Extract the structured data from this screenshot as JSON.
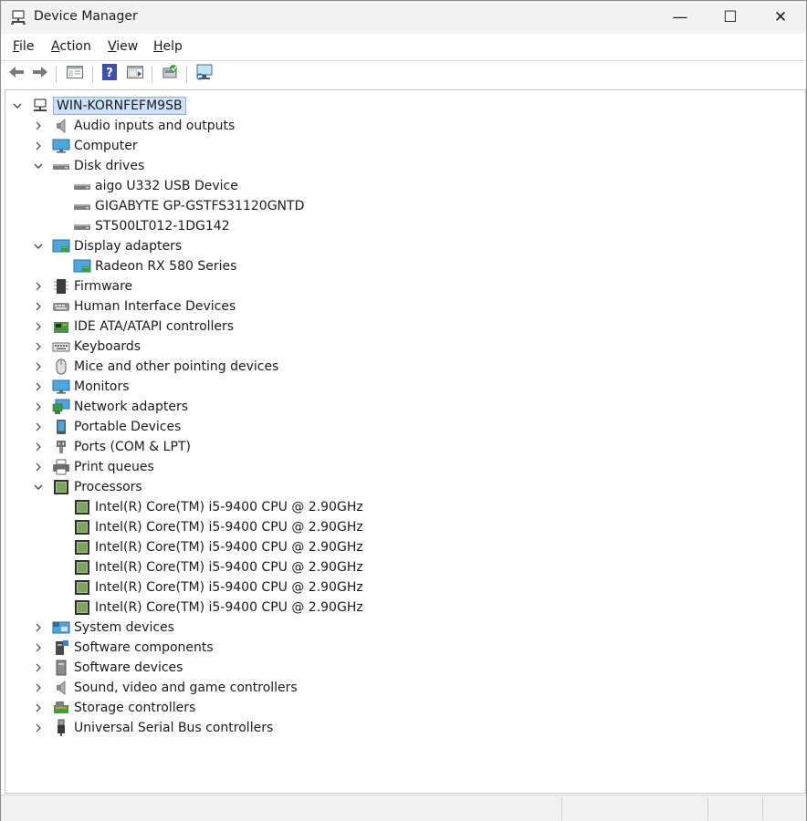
{
  "window": {
    "title": "Device Manager",
    "app_icon": "device-manager-icon",
    "controls": {
      "minimize": "—",
      "maximize": "☐",
      "close": "✕"
    }
  },
  "menu": {
    "file": {
      "mnemonic": "F",
      "rest": "ile"
    },
    "action": {
      "mnemonic": "A",
      "rest": "ction"
    },
    "view": {
      "mnemonic": "V",
      "rest": "iew"
    },
    "help": {
      "mnemonic": "H",
      "rest": "elp"
    }
  },
  "toolbar": {
    "buttons": [
      "back-arrow-icon",
      "forward-arrow-icon",
      "show-hide-console-tree-icon",
      "help-icon",
      "properties-icon",
      "update-driver-icon",
      "scan-hardware-icon"
    ]
  },
  "tree": {
    "root": {
      "label": "WIN-KORNFEFM9SB",
      "icon": "computer-network-icon"
    },
    "categories": {
      "audio": {
        "label": "Audio inputs and outputs",
        "icon": "speaker-icon"
      },
      "computer": {
        "label": "Computer",
        "icon": "monitor-icon"
      },
      "disk_drives": {
        "label": "Disk drives",
        "icon": "disk-drive-icon"
      },
      "display_adapters": {
        "label": "Display adapters",
        "icon": "display-adapter-icon"
      },
      "firmware": {
        "label": "Firmware",
        "icon": "chip-icon"
      },
      "hid": {
        "label": "Human Interface Devices",
        "icon": "hid-icon"
      },
      "ide": {
        "label": "IDE ATA/ATAPI controllers",
        "icon": "ide-controller-icon"
      },
      "keyboards": {
        "label": "Keyboards",
        "icon": "keyboard-icon"
      },
      "mice": {
        "label": "Mice and other pointing devices",
        "icon": "mouse-icon"
      },
      "monitors": {
        "label": "Monitors",
        "icon": "monitor-icon"
      },
      "network": {
        "label": "Network adapters",
        "icon": "network-adapter-icon"
      },
      "portable": {
        "label": "Portable Devices",
        "icon": "portable-device-icon"
      },
      "ports": {
        "label": "Ports (COM & LPT)",
        "icon": "port-icon"
      },
      "print_queues": {
        "label": "Print queues",
        "icon": "printer-icon"
      },
      "processors": {
        "label": "Processors",
        "icon": "processor-icon"
      },
      "system_devices": {
        "label": "System devices",
        "icon": "system-folder-icon"
      },
      "software_components": {
        "label": "Software components",
        "icon": "software-component-icon"
      },
      "software_devices": {
        "label": "Software devices",
        "icon": "software-device-icon"
      },
      "sound": {
        "label": "Sound, video and game controllers",
        "icon": "speaker-icon"
      },
      "storage": {
        "label": "Storage controllers",
        "icon": "storage-controller-icon"
      },
      "usb": {
        "label": "Universal Serial Bus controllers",
        "icon": "usb-icon"
      }
    },
    "disk_children": [
      "aigo U332 USB Device",
      "GIGABYTE GP-GSTFS31120GNTD",
      "ST500LT012-1DG142"
    ],
    "display_children": [
      "Radeon RX 580 Series"
    ],
    "processor_children": [
      "Intel(R) Core(TM) i5-9400 CPU @ 2.90GHz",
      "Intel(R) Core(TM) i5-9400 CPU @ 2.90GHz",
      "Intel(R) Core(TM) i5-9400 CPU @ 2.90GHz",
      "Intel(R) Core(TM) i5-9400 CPU @ 2.90GHz",
      "Intel(R) Core(TM) i5-9400 CPU @ 2.90GHz",
      "Intel(R) Core(TM) i5-9400 CPU @ 2.90GHz"
    ]
  },
  "status_bar": {
    "panes": [
      "",
      "",
      ""
    ]
  }
}
